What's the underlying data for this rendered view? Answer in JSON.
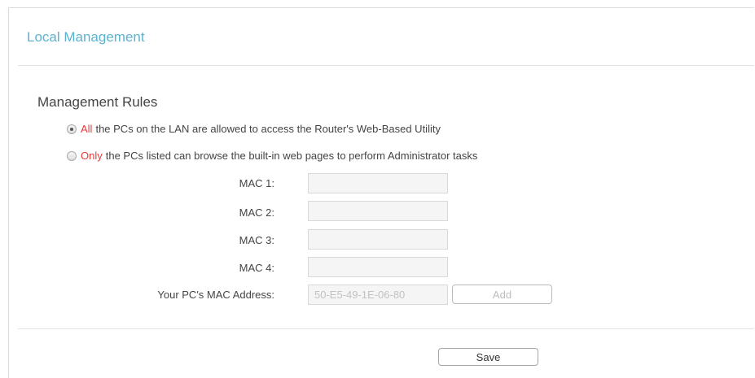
{
  "panel": {
    "title": "Local Management"
  },
  "management_rules": {
    "title": "Management Rules",
    "options": [
      {
        "highlight": "All",
        "text": "the PCs on the LAN are allowed to access the Router's Web-Based Utility",
        "selected": true
      },
      {
        "highlight": "Only",
        "text": "the PCs listed can browse the built-in web pages to perform Administrator tasks",
        "selected": false
      }
    ],
    "mac_fields": [
      {
        "label": "MAC 1:",
        "value": ""
      },
      {
        "label": "MAC 2:",
        "value": ""
      },
      {
        "label": "MAC 3:",
        "value": ""
      },
      {
        "label": "MAC 4:",
        "value": ""
      }
    ],
    "your_pc": {
      "label": "Your PC's MAC Address:",
      "value": "50-E5-49-1E-06-80",
      "add_label": "Add"
    }
  },
  "footer": {
    "save_label": "Save"
  },
  "colors": {
    "title_accent": "#5bb3cf",
    "highlight_red": "#e33b3b"
  }
}
